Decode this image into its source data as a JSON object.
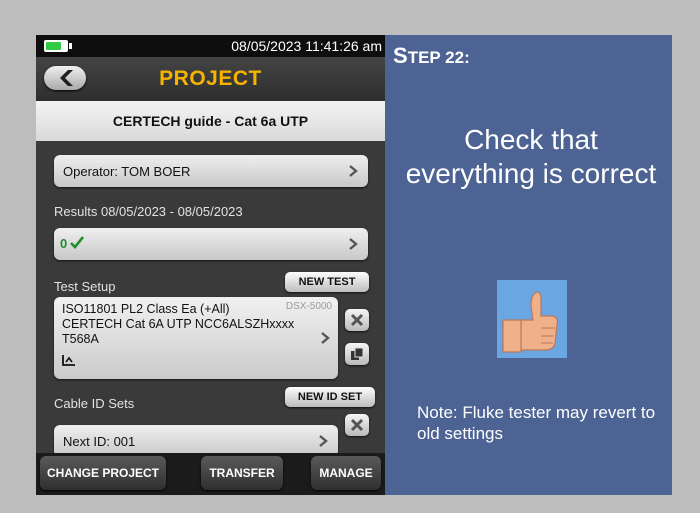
{
  "status_bar": {
    "datetime": "08/05/2023 11:41:26 am",
    "battery_level": 0.7,
    "battery_color": "#2ecc40"
  },
  "header": {
    "title": "PROJECT",
    "title_color": "#f5b400",
    "back_icon": "back-arrow-icon"
  },
  "project_name": "CERTECH guide - Cat 6a UTP",
  "operator": {
    "label": "Operator: TOM BOER"
  },
  "results": {
    "label": "Results 08/05/2023 - 08/05/2023",
    "pass_count": "0",
    "pass_icon": "checkmark-icon"
  },
  "test_setup": {
    "heading": "Test Setup",
    "new_test_label": "NEW TEST",
    "line1": "ISO11801 PL2 Class Ea (+All)",
    "line2": "CERTECH Cat 6A UTP NCC6ALSZHxxxx",
    "line3": "T568A",
    "model": "DSX-5000",
    "wiremap_icon": "wiremap-icon"
  },
  "cable_id": {
    "heading": "Cable ID Sets",
    "new_id_set_label": "NEW ID SET",
    "next_id_label": "Next ID: 001"
  },
  "bottom_bar": {
    "change_project": "CHANGE PROJECT",
    "transfer": "TRANSFER",
    "manage": "MANAGE"
  },
  "panel": {
    "step_prefix_big": "S",
    "step_rest": "TEP 22:",
    "instruction": "Check that everything is correct",
    "note": "Note: Fluke tester may revert to old settings",
    "image_icon": "thumbs-up-icon",
    "background": "#4d6394"
  }
}
